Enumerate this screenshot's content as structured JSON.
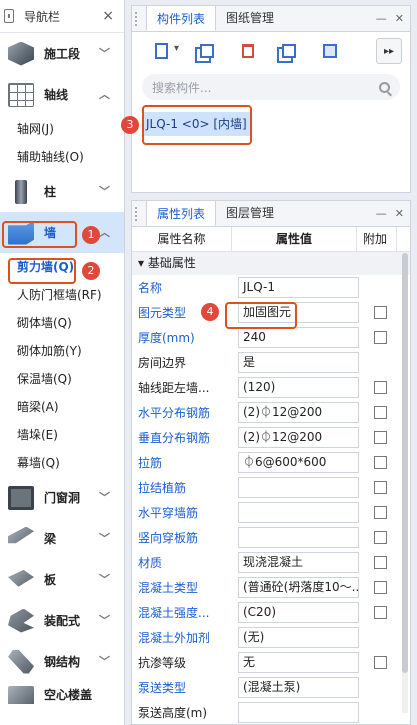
{
  "nav": {
    "title": "导航栏",
    "categories_top": [
      {
        "label": "施工段",
        "icon": "cube-icon"
      },
      {
        "label": "轴线",
        "icon": "grid-icon"
      }
    ],
    "axis_items": [
      "轴网(J)",
      "辅助轴线(O)"
    ],
    "column": {
      "label": "柱",
      "icon": "column-icon"
    },
    "wall": {
      "label": "墙",
      "icon": "wall-icon"
    },
    "wall_items": [
      "剪力墙(Q)",
      "人防门框墙(RF)",
      "砌体墙(Q)",
      "砌体加筋(Y)",
      "保温墙(Q)",
      "暗梁(A)",
      "墙垛(E)",
      "幕墙(Q)"
    ],
    "categories_bottom": [
      {
        "label": "门窗洞",
        "icon": "door-icon"
      },
      {
        "label": "梁",
        "icon": "beam-icon"
      },
      {
        "label": "板",
        "icon": "slab-icon"
      },
      {
        "label": "装配式",
        "icon": "prefab-icon"
      },
      {
        "label": "钢结构",
        "icon": "steel-icon"
      },
      {
        "label": "空心楼盖",
        "icon": "hollow-slab-icon"
      }
    ]
  },
  "top_panel": {
    "tabs": [
      "构件列表",
      "图纸管理"
    ],
    "search_placeholder": "搜索构件...",
    "items": [
      "JLQ-1 <0> [内墙]"
    ],
    "more": "▸▸"
  },
  "bottom_panel": {
    "tabs": [
      "属性列表",
      "图层管理"
    ],
    "headers": [
      "属性名称",
      "属性值",
      "附加"
    ],
    "group": "基础属性",
    "rows": [
      {
        "name": "名称",
        "value": "JLQ-1",
        "check": false,
        "blue": true
      },
      {
        "name": "图元类型",
        "value": "加固图元",
        "check": true,
        "blue": true
      },
      {
        "name": "厚度(mm)",
        "value": "240",
        "check": true,
        "blue": true
      },
      {
        "name": "房间边界",
        "value": "是",
        "check": false,
        "blue": false
      },
      {
        "name": "轴线距左墙...",
        "value": "(120)",
        "check": true,
        "blue": false
      },
      {
        "name": "水平分布钢筋",
        "value": "(2)⏀12@200",
        "check": true,
        "blue": true
      },
      {
        "name": "垂直分布钢筋",
        "value": "(2)⏀12@200",
        "check": true,
        "blue": true
      },
      {
        "name": "拉筋",
        "value": "⏀6@600*600",
        "check": true,
        "blue": true
      },
      {
        "name": "拉结植筋",
        "value": "",
        "check": true,
        "blue": true
      },
      {
        "name": "水平穿墙筋",
        "value": "",
        "check": true,
        "blue": true
      },
      {
        "name": "竖向穿板筋",
        "value": "",
        "check": true,
        "blue": true
      },
      {
        "name": "材质",
        "value": "现浇混凝土",
        "check": true,
        "blue": true
      },
      {
        "name": "混凝土类型",
        "value": "(普通砼(坍落度10～...",
        "check": true,
        "blue": true
      },
      {
        "name": "混凝土强度...",
        "value": "(C20)",
        "check": true,
        "blue": true
      },
      {
        "name": "混凝土外加剂",
        "value": "(无)",
        "check": false,
        "blue": true
      },
      {
        "name": "抗渗等级",
        "value": "无",
        "check": true,
        "blue": false
      },
      {
        "name": "泵送类型",
        "value": "(混凝土泵)",
        "check": false,
        "blue": true
      },
      {
        "name": "泵送高度(m)",
        "value": "",
        "check": false,
        "blue": false
      }
    ]
  },
  "callouts": [
    "1",
    "2",
    "3",
    "4"
  ]
}
